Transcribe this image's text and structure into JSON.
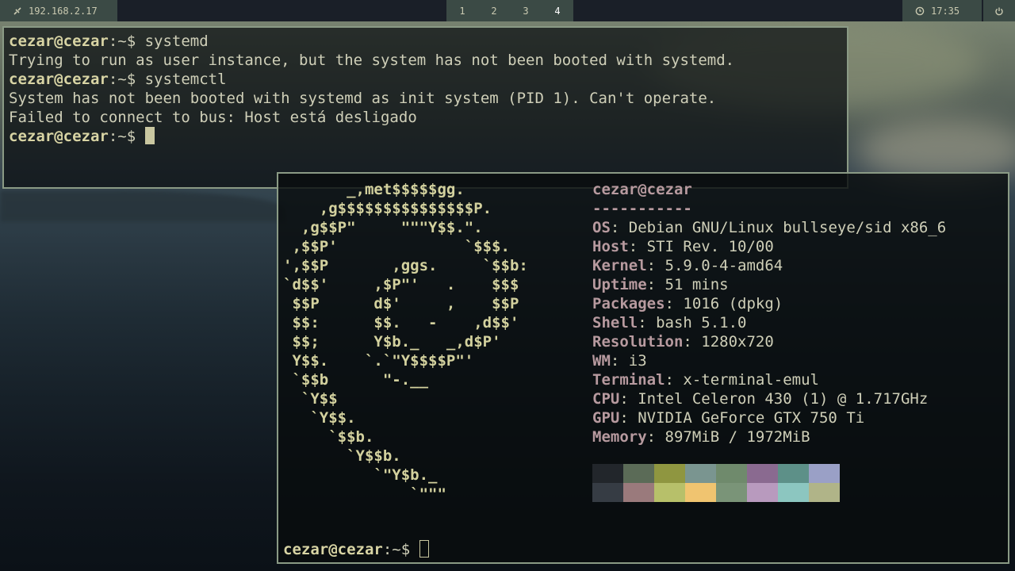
{
  "topbar": {
    "ip": "192.168.2.17",
    "workspaces": [
      "1",
      "2",
      "3",
      "4"
    ],
    "active_workspace": "4",
    "clock": "17:35"
  },
  "term1": {
    "lines": [
      {
        "user": "cezar@cezar",
        "prompt": ":~$ ",
        "cmd": "systemd"
      },
      {
        "text": "Trying to run as user instance, but the system has not been booted with systemd."
      },
      {
        "user": "cezar@cezar",
        "prompt": ":~$ ",
        "cmd": "systemctl"
      },
      {
        "text": "System has not been booted with systemd as init system (PID 1). Can't operate."
      },
      {
        "text": "Failed to connect to bus: Host está desligado"
      },
      {
        "user": "cezar@cezar",
        "prompt": ":~$ ",
        "cmd": ""
      }
    ]
  },
  "term2": {
    "ascii_art": [
      "       _,met$$$$$gg.",
      "    ,g$$$$$$$$$$$$$$$P.",
      "  ,g$$P\"     \"\"\"Y$$.\".",
      " ,$$P'              `$$$.",
      "',$$P       ,ggs.     `$$b:",
      "`d$$'     ,$P\"'   .    $$$",
      " $$P      d$'     ,    $$P",
      " $$:      $$.   -    ,d$$'",
      " $$;      Y$b._   _,d$P'",
      " Y$$.    `.`\"Y$$$$P\"'",
      " `$$b      \"-.__",
      "  `Y$$",
      "   `Y$$.",
      "     `$$b.",
      "       `Y$$b.",
      "          `\"Y$b._",
      "              `\"\"\""
    ],
    "title": "cezar@cezar",
    "separator": "-----------",
    "info": [
      {
        "key": "OS",
        "value": "Debian GNU/Linux bullseye/sid x86_6"
      },
      {
        "key": "Host",
        "value": "STI Rev. 10/00"
      },
      {
        "key": "Kernel",
        "value": "5.9.0-4-amd64"
      },
      {
        "key": "Uptime",
        "value": "51 mins"
      },
      {
        "key": "Packages",
        "value": "1016 (dpkg)"
      },
      {
        "key": "Shell",
        "value": "bash 5.1.0"
      },
      {
        "key": "Resolution",
        "value": "1280x720"
      },
      {
        "key": "WM",
        "value": "i3"
      },
      {
        "key": "Terminal",
        "value": "x-terminal-emul"
      },
      {
        "key": "CPU",
        "value": "Intel Celeron 430 (1) @ 1.717GHz"
      },
      {
        "key": "GPU",
        "value": "NVIDIA GeForce GTX 750 Ti"
      },
      {
        "key": "Memory",
        "value": "897MiB / 1972MiB"
      }
    ],
    "palette": [
      "#22262b",
      "#5b6b57",
      "#8f9640",
      "#7a9590",
      "#6f8a6c",
      "#8a6a90",
      "#5d9088",
      "#9aa0c6",
      "#363c44",
      "#9a7a7c",
      "#b7c06a",
      "#f0c470",
      "#7a9478",
      "#b89abe",
      "#8cc6c0",
      "#b0b488"
    ],
    "prompt": {
      "user": "cezar@cezar",
      "prompt": ":~$ "
    }
  }
}
